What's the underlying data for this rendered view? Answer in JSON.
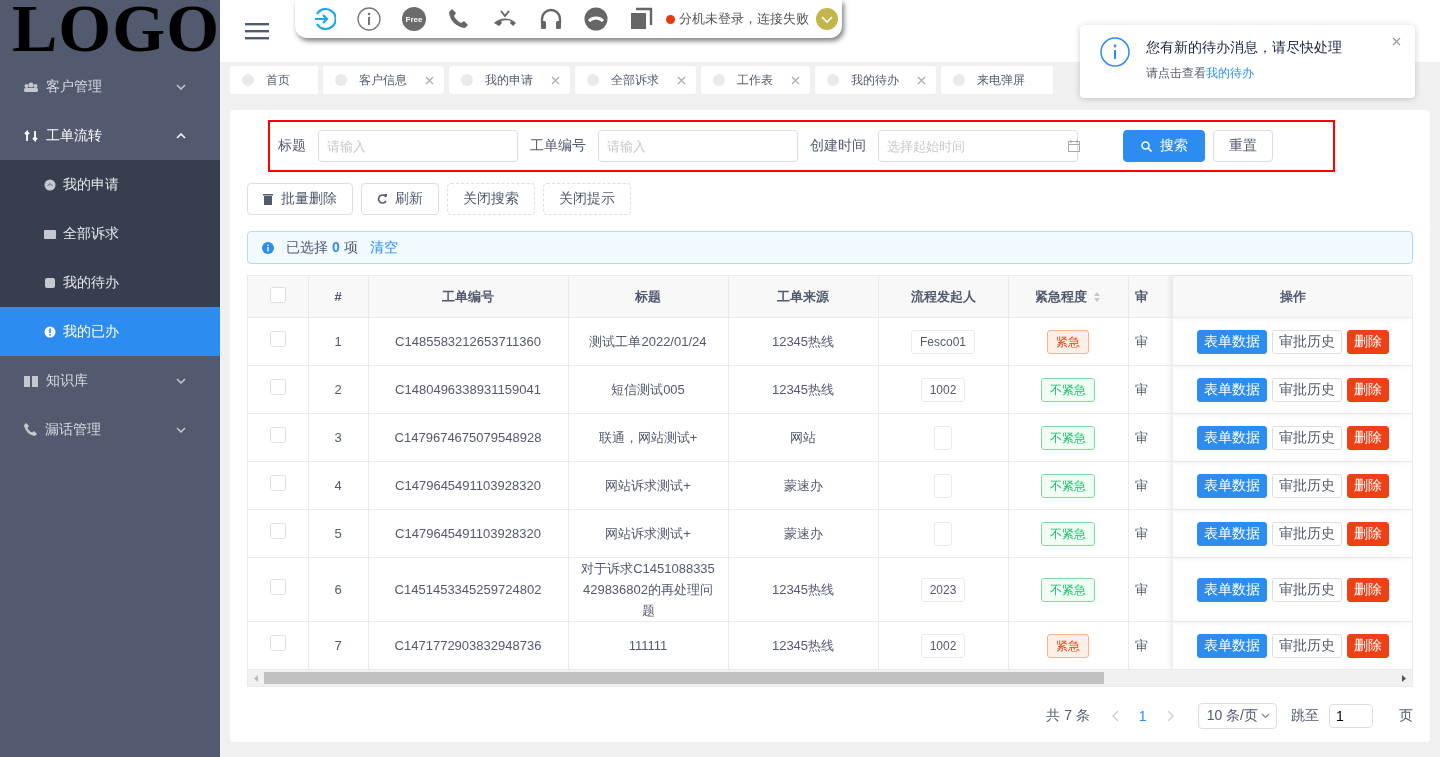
{
  "logo": "LOGO",
  "sidebar": {
    "items": [
      {
        "label": "客户管理",
        "expanded": false
      },
      {
        "label": "工单流转",
        "expanded": true,
        "children": [
          {
            "label": "我的申请",
            "selected": false
          },
          {
            "label": "全部诉求",
            "selected": false
          },
          {
            "label": "我的待办",
            "selected": false
          },
          {
            "label": "我的已办",
            "selected": true
          }
        ]
      },
      {
        "label": "知识库",
        "expanded": false
      },
      {
        "label": "漏话管理",
        "expanded": false
      }
    ]
  },
  "softphone": {
    "badge": "Free",
    "status": "分机未登录，连接失败",
    "connected": false
  },
  "tabs": [
    {
      "label": "首页",
      "closable": false,
      "selected": false
    },
    {
      "label": "客户信息",
      "closable": true,
      "selected": false
    },
    {
      "label": "我的申请",
      "closable": true,
      "selected": false
    },
    {
      "label": "全部诉求",
      "closable": true,
      "selected": false
    },
    {
      "label": "工作表",
      "closable": true,
      "selected": false
    },
    {
      "label": "我的待办",
      "closable": true,
      "selected": false
    },
    {
      "label": "来电弹屏",
      "closable": false,
      "selected": false
    }
  ],
  "notification": {
    "title": "您有新的待办消息，请尽快处理",
    "text": "请点击查看",
    "link": "我的待办"
  },
  "search": {
    "fields": [
      {
        "label": "标题",
        "placeholder": "请输入",
        "kind": "text"
      },
      {
        "label": "工单编号",
        "placeholder": "请输入",
        "kind": "text"
      },
      {
        "label": "创建时间",
        "placeholder": "选择起始时间",
        "kind": "date"
      }
    ],
    "buttons": [
      {
        "label": "搜索",
        "kind": "primary"
      },
      {
        "label": "重置",
        "kind": "default"
      }
    ]
  },
  "toolbar": [
    {
      "label": "批量删除",
      "kind": "solid"
    },
    {
      "label": "刷新",
      "kind": "solid"
    },
    {
      "label": "关闭搜索",
      "kind": "dashed"
    },
    {
      "label": "关闭提示",
      "kind": "dashed"
    }
  ],
  "alert": {
    "prefix": "已选择",
    "count": "0",
    "suffix": "项",
    "link": "清空"
  },
  "table": {
    "header_checked": false,
    "columns": [
      {
        "label": "#",
        "sortable": false
      },
      {
        "label": "工单编号",
        "sortable": false
      },
      {
        "label": "标题",
        "sortable": false
      },
      {
        "label": "工单来源",
        "sortable": false
      },
      {
        "label": "流程发起人",
        "sortable": false
      },
      {
        "label": "紧急程度",
        "sortable": true
      },
      {
        "label": "审",
        "sortable": false
      },
      {
        "label": "操作",
        "sortable": false
      }
    ],
    "rows": [
      {
        "checked": false,
        "index": "1",
        "order_no": "C1485583212653711360",
        "title": "测试工单2022/01/24",
        "source": "12345热线",
        "initiator": "Fesco01",
        "urgency": "紧急",
        "urgent": true,
        "column_8": "审",
        "actions": [
          "表单数据",
          "审批历史",
          "删除"
        ]
      },
      {
        "checked": false,
        "index": "2",
        "order_no": "C1480496338931159041",
        "title": "短信测试005",
        "source": "12345热线",
        "initiator": "1002",
        "urgency": "不紧急",
        "urgent": false,
        "column_8": "审",
        "actions": [
          "表单数据",
          "审批历史",
          "删除"
        ]
      },
      {
        "checked": false,
        "index": "3",
        "order_no": "C1479674675079548928",
        "title": "联通，网站测试+",
        "source": "网站",
        "urgency": "不紧急",
        "urgent": false,
        "column_8": "审",
        "actions": [
          "表单数据",
          "审批历史",
          "删除"
        ]
      },
      {
        "checked": false,
        "index": "4",
        "order_no": "C1479645491103928320",
        "title": "网站诉求测试+",
        "source": "蒙速办",
        "urgency": "不紧急",
        "urgent": false,
        "column_8": "审",
        "actions": [
          "表单数据",
          "审批历史",
          "删除"
        ]
      },
      {
        "checked": false,
        "index": "5",
        "order_no": "C1479645491103928320",
        "title": "网站诉求测试+",
        "source": "蒙速办",
        "urgency": "不紧急",
        "urgent": false,
        "column_8": "审",
        "actions": [
          "表单数据",
          "审批历史",
          "删除"
        ]
      },
      {
        "checked": false,
        "index": "6",
        "order_no": "C1451453345259724802",
        "title": "对于诉求C1451088335429836802的再处理问题",
        "source": "12345热线",
        "initiator": "2023",
        "urgency": "不紧急",
        "urgent": false,
        "column_8": "审",
        "actions": [
          "表单数据",
          "审批历史",
          "删除"
        ]
      },
      {
        "checked": false,
        "index": "7",
        "order_no": "C1471772903832948736",
        "title": "111111",
        "source": "12345热线",
        "initiator": "1002",
        "urgency": "紧急",
        "urgent": true,
        "column_8": "审",
        "actions": [
          "表单数据",
          "审批历史",
          "删除"
        ]
      }
    ]
  },
  "pagination": {
    "total": "共 7 条",
    "pages": [
      {
        "label": "1",
        "selected": true
      }
    ],
    "page_size": "10 条/页",
    "jump_label": "跳至",
    "jump_value": "1",
    "page_suffix": "页"
  }
}
